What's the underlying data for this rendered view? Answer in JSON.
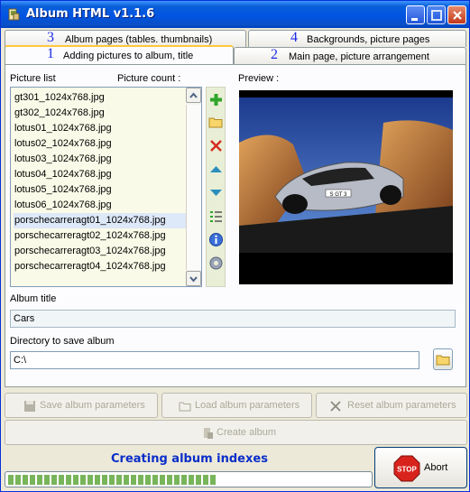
{
  "window": {
    "title": "Album HTML v1.1.6"
  },
  "tabs": [
    {
      "num": "3",
      "label": "Album pages (tables. thumbnails)",
      "active": false
    },
    {
      "num": "4",
      "label": "Backgrounds, picture pages",
      "active": false
    },
    {
      "num": "1",
      "label": "Adding pictures to album, title",
      "active": true
    },
    {
      "num": "2",
      "label": "Main page, picture arrangement",
      "active": false
    }
  ],
  "picture_list": {
    "label": "Picture list",
    "count_label": "Picture count :",
    "items": [
      "gt301_1024x768.jpg",
      "gt302_1024x768.jpg",
      "lotus01_1024x768.jpg",
      "lotus02_1024x768.jpg",
      "lotus03_1024x768.jpg",
      "lotus04_1024x768.jpg",
      "lotus05_1024x768.jpg",
      "lotus06_1024x768.jpg",
      "porschecarreragt01_1024x768.jpg",
      "porschecarreragt02_1024x768.jpg",
      "porschecarreragt03_1024x768.jpg",
      "porschecarreragt04_1024x768.jpg"
    ],
    "selected_index": 8
  },
  "side_toolbar": [
    "add-icon",
    "open-folder-icon",
    "delete-icon",
    "move-up-icon",
    "move-down-icon",
    "list-icon",
    "info-icon",
    "settings-icon"
  ],
  "preview": {
    "label": "Preview :",
    "plate_text": "S GT 3"
  },
  "album_title": {
    "label": "Album title",
    "value": "Cars"
  },
  "directory": {
    "label": "Directory to save album",
    "value": "C:\\"
  },
  "buttons": {
    "save": "Save album parameters",
    "load": "Load album parameters",
    "reset": "Reset album parameters",
    "create": "Create album",
    "abort": "Abort"
  },
  "status": {
    "text": "Creating album indexes",
    "progress": 0.58
  },
  "colors": {
    "accent_tab_number": "#1a2be8",
    "status_text": "#0a2ec8",
    "progress_fill": "#78b55a"
  }
}
